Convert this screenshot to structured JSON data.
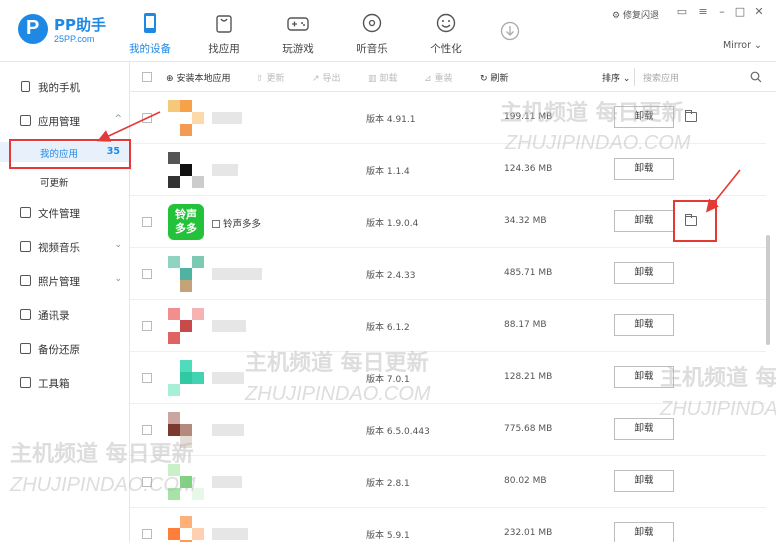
{
  "app": {
    "name": "PP助手",
    "domain": "25PP.com"
  },
  "nav": [
    {
      "label": "我的设备",
      "icon": "phone-icon",
      "active": true
    },
    {
      "label": "找应用",
      "icon": "bag-icon"
    },
    {
      "label": "玩游戏",
      "icon": "gamepad-icon"
    },
    {
      "label": "听音乐",
      "icon": "music-disc-icon"
    },
    {
      "label": "个性化",
      "icon": "smile-icon"
    },
    {
      "label": "",
      "icon": "download-icon"
    }
  ],
  "window": {
    "repair": "修复闪退",
    "device": "Mirror"
  },
  "sidebar": {
    "my_phone": "我的手机",
    "app_manage": "应用管理",
    "my_apps": "我的应用",
    "my_apps_count": "35",
    "updatable": "可更新",
    "file_manage": "文件管理",
    "video_music": "视频音乐",
    "photo_manage": "照片管理",
    "contacts": "通讯录",
    "backup": "备份还原",
    "toolbox": "工具箱"
  },
  "toolbar": {
    "install_local": "安装本地应用",
    "update": "更新",
    "export": "导出",
    "uninstall": "卸载",
    "reinstall": "重装",
    "refresh": "刷新",
    "sort": "排序",
    "search_placeholder": "搜索应用"
  },
  "rows": [
    {
      "name": "",
      "version": "版本 4.91.1",
      "size": "199.11 MB",
      "action": "卸载",
      "folder": true,
      "colors": [
        "#f5c87a",
        "#f7a24b",
        "#fbd9a8",
        "#f39b53"
      ]
    },
    {
      "name": "",
      "version": "版本 1.1.4",
      "size": "124.36 MB",
      "action": "卸载",
      "folder": false,
      "colors": [
        "#555555",
        "#111111",
        "#cccccc",
        "#333333"
      ]
    },
    {
      "name": "铃声多多",
      "version": "版本 1.9.0.4",
      "size": "34.32 MB",
      "action": "卸载",
      "folder": true,
      "logo_text": "铃声多多"
    },
    {
      "name": "",
      "version": "版本 2.4.33",
      "size": "485.71 MB",
      "action": "卸载",
      "folder": false,
      "colors": [
        "#8fd3c2",
        "#4fb3a2",
        "#c5a37a",
        "#7cc9b4"
      ]
    },
    {
      "name": "",
      "version": "版本 6.1.2",
      "size": "88.17 MB",
      "action": "卸载",
      "folder": false,
      "colors": [
        "#f28e8e",
        "#c84b4b",
        "#f5b3b3",
        "#e06363"
      ]
    },
    {
      "name": "",
      "version": "版本 7.0.1",
      "size": "128.21 MB",
      "action": "卸载",
      "folder": false,
      "colors": [
        "#4fdcbc",
        "#2fc9a3",
        "#a8efd9",
        "#44d3b0"
      ]
    },
    {
      "name": "",
      "version": "版本 6.5.0.443",
      "size": "775.68 MB",
      "action": "卸载",
      "folder": false,
      "colors": [
        "#c9a7a0",
        "#7a3a2e",
        "#e8dcd6",
        "#b48a7e"
      ]
    },
    {
      "name": "",
      "version": "版本 2.8.1",
      "size": "80.02 MB",
      "action": "卸载",
      "folder": false,
      "colors": [
        "#c9f0c9",
        "#7cd57c",
        "#e8f8e8",
        "#a5e4a5"
      ]
    },
    {
      "name": "",
      "version": "版本 5.9.1",
      "size": "232.01 MB",
      "action": "卸载",
      "folder": false,
      "colors": [
        "#ffb07a",
        "#ff7f3a",
        "#ffd0b0",
        "#ff9a55"
      ]
    }
  ],
  "watermark": {
    "cn": "主机频道 每日更新",
    "en": "ZHUJIPINDAO.COM"
  }
}
